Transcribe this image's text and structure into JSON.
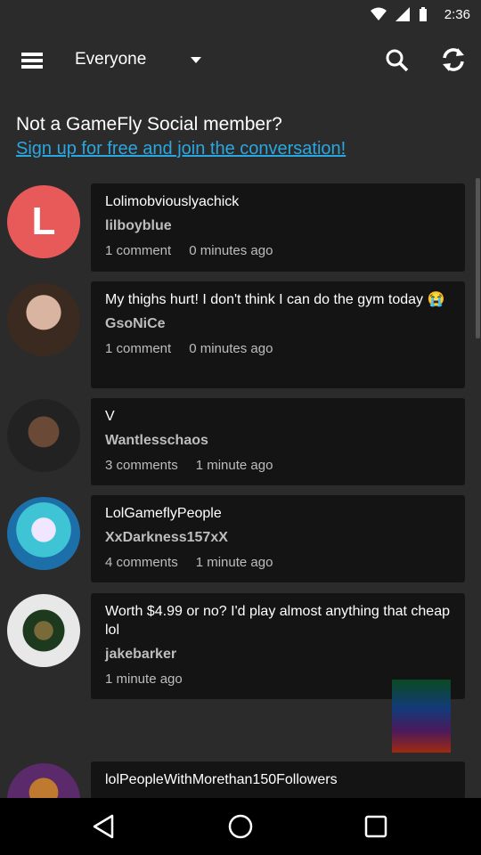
{
  "status": {
    "time": "2:36"
  },
  "toolbar": {
    "filter_label": "Everyone"
  },
  "promo": {
    "title": "Not a GameFly Social member?",
    "link": "Sign up for free and join the conversation!"
  },
  "feed": [
    {
      "title": "Lolimobviouslyachick",
      "user": "lilboyblue",
      "comments": "1 comment",
      "time": "0 minutes ago",
      "avatar_letter": "L"
    },
    {
      "title": "My thighs hurt! I don't think I can do the gym today 😭",
      "user": "GsoNiCe",
      "comments": "1 comment",
      "time": "0 minutes ago"
    },
    {
      "title": "V",
      "user": "Wantlesschaos",
      "comments": "3 comments",
      "time": "1 minute ago"
    },
    {
      "title": "LolGameflyPeople",
      "user": "XxDarkness157xX",
      "comments": "4 comments",
      "time": "1 minute ago"
    },
    {
      "title": "Worth $4.99 or no? I'd play almost anything that cheap lol",
      "user": "jakebarker",
      "comments": "",
      "time": "1 minute ago"
    },
    {
      "title": "lolPeopleWithMorethan150Followers",
      "user": "",
      "comments": "",
      "time": ""
    }
  ],
  "colors": {
    "accent": "#2aa6e0",
    "avatar_red": "#e85a5a",
    "card_bg": "#141414",
    "page_bg": "#2b2b2b"
  }
}
